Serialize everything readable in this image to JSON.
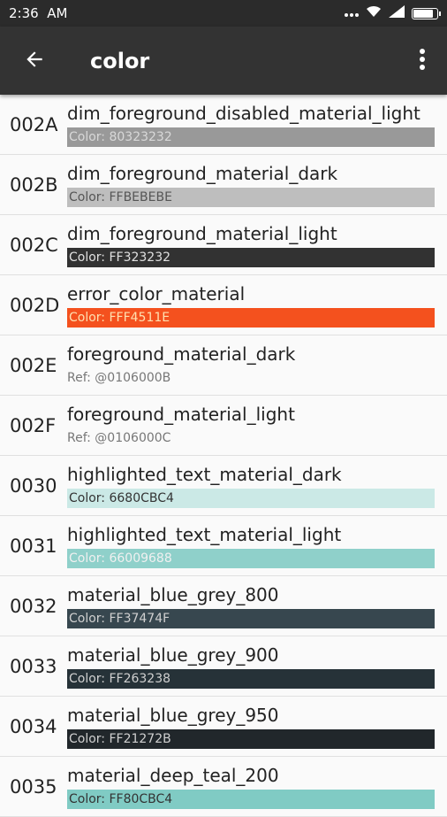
{
  "status_bar": {
    "time": "2:36",
    "ampm": "AM",
    "signal_icon": "signal-icon",
    "wifi_icon": "wifi-icon",
    "battery_icon": "battery-icon",
    "battery_level_percent": 85
  },
  "toolbar": {
    "title": "color",
    "back_icon": "arrow-back-icon",
    "more_icon": "more-vertical-icon"
  },
  "rows": [
    {
      "id": "002A",
      "name": "dim_foreground_disabled_material_light",
      "kind": "color",
      "value": "Color: 80323232",
      "bg": "#999999",
      "fg": "#d8d8d8"
    },
    {
      "id": "002B",
      "name": "dim_foreground_material_dark",
      "kind": "color",
      "value": "Color: FFBEBEBE",
      "bg": "#bebebe",
      "fg": "#555555"
    },
    {
      "id": "002C",
      "name": "dim_foreground_material_light",
      "kind": "color",
      "value": "Color: FF323232",
      "bg": "#323232",
      "fg": "#e0e0e0"
    },
    {
      "id": "002D",
      "name": "error_color_material",
      "kind": "color",
      "value": "Color: FFF4511E",
      "bg": "#f4511e",
      "fg": "#ffe0b0"
    },
    {
      "id": "002E",
      "name": "foreground_material_dark",
      "kind": "ref",
      "value": "Ref: @0106000B"
    },
    {
      "id": "002F",
      "name": "foreground_material_light",
      "kind": "ref",
      "value": "Ref: @0106000C"
    },
    {
      "id": "0030",
      "name": "highlighted_text_material_dark",
      "kind": "color",
      "value": "Color: 6680CBC4",
      "bg": "#cbe9e6",
      "fg": "#333333"
    },
    {
      "id": "0031",
      "name": "highlighted_text_material_light",
      "kind": "color",
      "value": "Color: 66009688",
      "bg": "#8fd0ca",
      "fg": "#f0f0f0"
    },
    {
      "id": "0032",
      "name": "material_blue_grey_800",
      "kind": "color",
      "value": "Color: FF37474F",
      "bg": "#37474f",
      "fg": "#d0d0d0"
    },
    {
      "id": "0033",
      "name": "material_blue_grey_900",
      "kind": "color",
      "value": "Color: FF263238",
      "bg": "#263238",
      "fg": "#d0d0d0"
    },
    {
      "id": "0034",
      "name": "material_blue_grey_950",
      "kind": "color",
      "value": "Color: FF21272B",
      "bg": "#21272b",
      "fg": "#d0d0d0"
    },
    {
      "id": "0035",
      "name": "material_deep_teal_200",
      "kind": "color",
      "value": "Color: FF80CBC4",
      "bg": "#80cbc4",
      "fg": "#333333"
    }
  ]
}
